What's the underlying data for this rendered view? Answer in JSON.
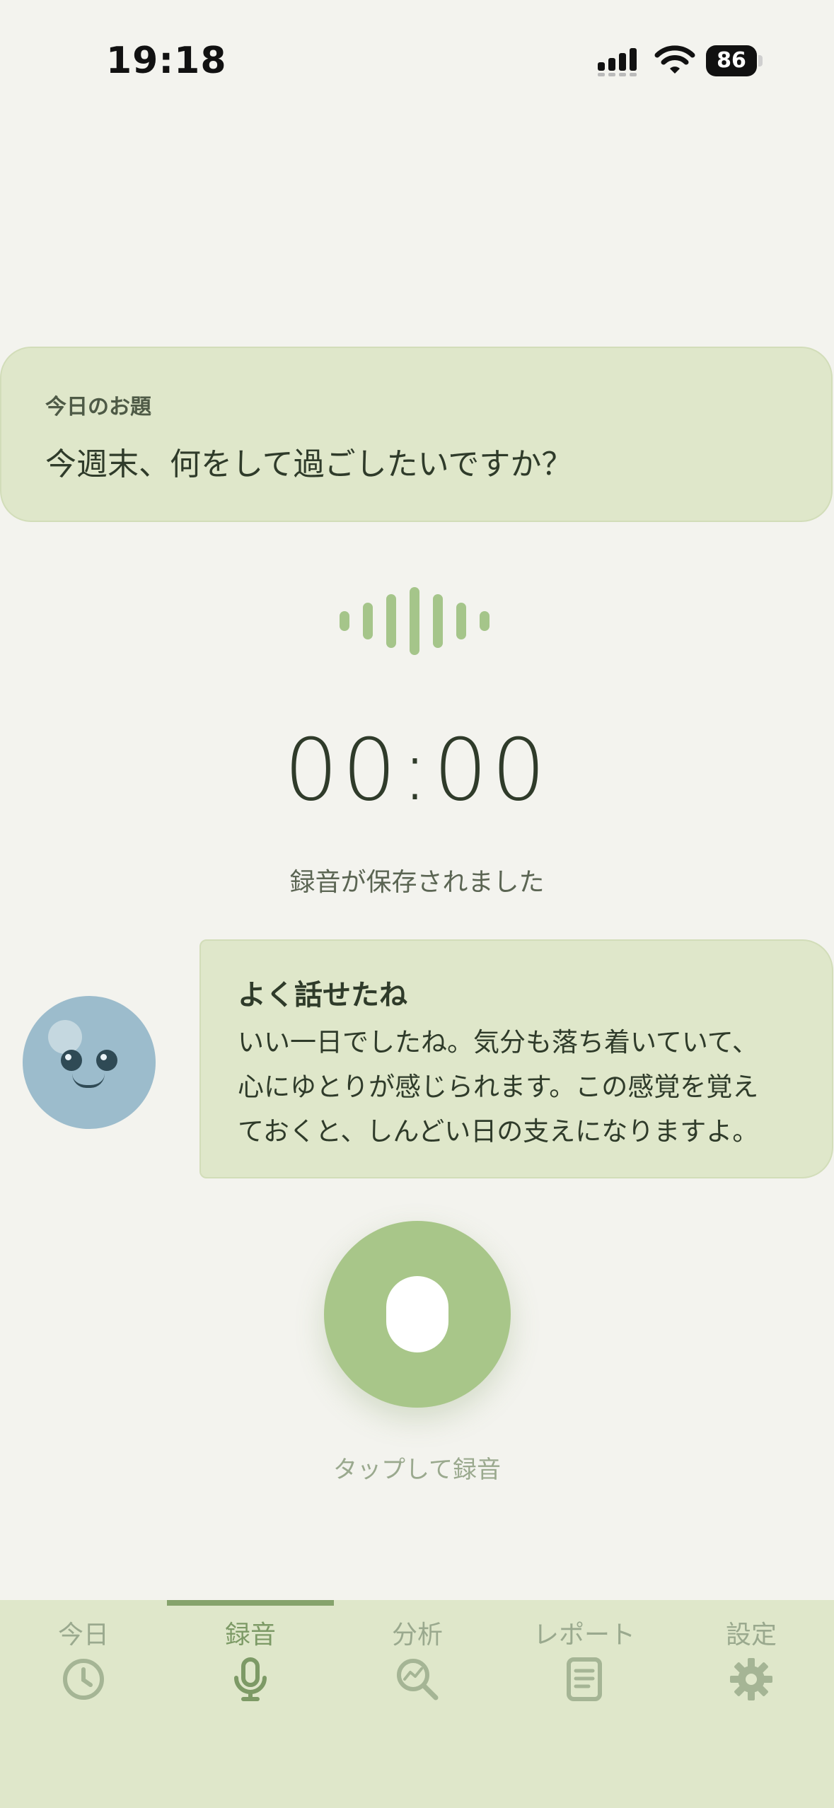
{
  "status_bar": {
    "time": "19:18",
    "battery": "86"
  },
  "prompt": {
    "label": "今日のお題",
    "question": "今週末、何をして過ごしたいですか？"
  },
  "recorder": {
    "timer": "00:00",
    "status": "録音が保存されました",
    "hint": "タップして録音"
  },
  "feedback": {
    "title": "よく話せたね",
    "lines": [
      "いい一日でしたね。気分も落ち着いていて、",
      "心にゆとりが感じられます。この感覚を覚え",
      "ておくと、しんどい日の支えになりますよ。"
    ]
  },
  "tabs": [
    {
      "label": "今日",
      "icon": "clock-icon",
      "active": false
    },
    {
      "label": "録音",
      "icon": "microphone-icon",
      "active": true
    },
    {
      "label": "分析",
      "icon": "analysis-search-icon",
      "active": false
    },
    {
      "label": "レポート",
      "icon": "document-icon",
      "active": false
    },
    {
      "label": "設定",
      "icon": "gear-icon",
      "active": false
    }
  ],
  "colors": {
    "background": "#f3f3ee",
    "card": "#dfe7ca",
    "accent": "#a8c689",
    "text": "#2f3b2a",
    "mascot": "#9cbccc"
  }
}
